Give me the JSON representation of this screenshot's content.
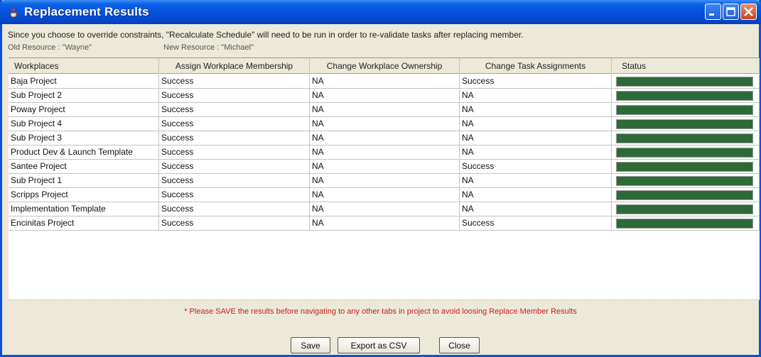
{
  "window": {
    "title": "Replacement Results"
  },
  "info_message": "Since you choose to override constraints, \"Recalculate Schedule\" will need to be run in order to re-validate tasks after replacing member.",
  "old_resource": "Old Resource : \"Wayne\"",
  "new_resource": "New Resource : \"Michael\"",
  "table": {
    "columns": [
      "Workplaces",
      "Assign Workplace Membership",
      "Change Workplace Ownership",
      "Change Task Assignments",
      "Status"
    ],
    "rows": [
      [
        "Baja Project",
        "Success",
        "NA",
        "Success"
      ],
      [
        "Sub Project 2",
        "Success",
        "NA",
        "NA"
      ],
      [
        "Poway Project",
        "Success",
        "NA",
        "NA"
      ],
      [
        "Sub Project 4",
        "Success",
        "NA",
        "NA"
      ],
      [
        "Sub Project 3",
        "Success",
        "NA",
        "NA"
      ],
      [
        "Product Dev & Launch Template",
        "Success",
        "NA",
        "NA"
      ],
      [
        "Santee Project",
        "Success",
        "NA",
        "Success"
      ],
      [
        "Sub Project 1",
        "Success",
        "NA",
        "NA"
      ],
      [
        "Scripps Project",
        "Success",
        "NA",
        "NA"
      ],
      [
        "Implementation Template",
        "Success",
        "NA",
        "NA"
      ],
      [
        "Encinitas Project",
        "Success",
        "NA",
        "Success"
      ]
    ],
    "status_progress": [
      1,
      1,
      1,
      1,
      1,
      1,
      1,
      1,
      1,
      1,
      1
    ],
    "status_color": "#2d6a37"
  },
  "warning_message": "* Please SAVE the results before navigating to any other tabs in project to avoid loosing Replace Member Results",
  "buttons": {
    "save": "Save",
    "export_csv": "Export as CSV",
    "close": "Close"
  },
  "colors": {
    "title_bar": "#0650d9",
    "window_bg": "#ece9d8",
    "warning_text": "#cc1d1d"
  },
  "icons": {
    "app": "java-cup-icon",
    "minimize": "minimize-icon",
    "maximize": "maximize-icon",
    "close": "close-icon"
  }
}
